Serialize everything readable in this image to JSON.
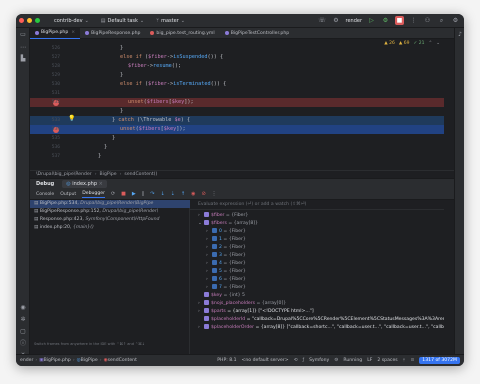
{
  "title_bar": {
    "project": "contrib-dev",
    "task": "Default task",
    "branch": "master",
    "run_config": "render"
  },
  "tabs": [
    {
      "label": "BigPipe.php",
      "color": "#8b7bd8",
      "active": true
    },
    {
      "label": "BigPipeResponse.php",
      "color": "#8b7bd8",
      "active": false
    },
    {
      "label": "big_pipe.test_routing.yml",
      "color": "#db5c5c",
      "active": false
    },
    {
      "label": "BigPipeTestController.php",
      "color": "#8b7bd8",
      "active": false
    }
  ],
  "editor": {
    "inspections": {
      "warnings": "26",
      "weak": "69",
      "typos": "21"
    },
    "lines": [
      {
        "num": "526",
        "code": "}"
      },
      {
        "num": "527",
        "code": "else if ($fiber->isSuspended()) {"
      },
      {
        "num": "528",
        "code": "$fiber->resume();"
      },
      {
        "num": "529",
        "code": "}"
      },
      {
        "num": "530",
        "code": "else if ($fiber->isTerminated()) {"
      },
      {
        "num": "531",
        "code": "unset($fibers[$key]);"
      },
      {
        "num": "532",
        "code": "}"
      },
      {
        "num": "533",
        "code": "} catch (\\Throwable $e) {"
      },
      {
        "num": "534",
        "code": "unset($fibers[$key]);"
      },
      {
        "num": "535",
        "code": "}"
      },
      {
        "num": "536",
        "code": "}"
      },
      {
        "num": "537",
        "code": "}"
      }
    ]
  },
  "breadcrumb": [
    "\\Drupal\\big_pipe\\Render",
    "BigPipe",
    "sendContent()"
  ],
  "debug": {
    "title": "Debug",
    "session": "index.php",
    "tabs": [
      "Console",
      "Output",
      "Debugger"
    ],
    "eval_placeholder": "Evaluate expression (⏎) or add a watch (⇧⌘⏎)",
    "frames": [
      {
        "text": "BigPipe.php:534, ",
        "ctx": "Drupal\\big_pipe\\Render\\BigPipe",
        "selected": true
      },
      {
        "text": "BigPipeResponse.php:152, ",
        "ctx": "Drupal\\big_pipe\\Render\\",
        "selected": false
      },
      {
        "text": "Response.php:423, ",
        "ctx": "Symfony\\Component\\HttpFound",
        "selected": false
      },
      {
        "text": "index.php:20, ",
        "ctx": "{main}()",
        "selected": false
      }
    ],
    "frames_hint": "Switch frames from anywhere in the IDE with ⌃⌘↑ and ⌃⌘↓",
    "vars": [
      {
        "indent": 0,
        "arrow": ">",
        "name": "$fiber",
        "value": "= {Fiber}"
      },
      {
        "indent": 0,
        "arrow": "v",
        "name": "$fibers",
        "value": "= {array[8]}"
      },
      {
        "indent": 1,
        "arrow": ">",
        "name": "0",
        "value": "= {Fiber}"
      },
      {
        "indent": 1,
        "arrow": ">",
        "name": "1",
        "value": "= {Fiber}"
      },
      {
        "indent": 1,
        "arrow": ">",
        "name": "2",
        "value": "= {Fiber}"
      },
      {
        "indent": 1,
        "arrow": ">",
        "name": "3",
        "value": "= {Fiber}"
      },
      {
        "indent": 1,
        "arrow": ">",
        "name": "4",
        "value": "= {Fiber}"
      },
      {
        "indent": 1,
        "arrow": ">",
        "name": "5",
        "value": "= {Fiber}"
      },
      {
        "indent": 1,
        "arrow": ">",
        "name": "6",
        "value": "= {Fiber}"
      },
      {
        "indent": 1,
        "arrow": ">",
        "name": "7",
        "value": "= {Fiber}"
      },
      {
        "indent": 0,
        "arrow": "",
        "name": "$key",
        "value": "= {int} 5"
      },
      {
        "indent": 0,
        "arrow": ">",
        "name": "$nojs_placeholders",
        "value": "= {array[0]}"
      },
      {
        "indent": 0,
        "arrow": ">",
        "name": "$parts",
        "value": "= {array[1]} [\"<!DOCTYPE html>...\"]"
      },
      {
        "indent": 0,
        "arrow": "",
        "name": "$placeholderId",
        "value": "= \"callback=Drupal%5CCore%5CRender%5CElement%5CStatusMessages%3A%3ArenderM"
      },
      {
        "indent": 0,
        "arrow": ">",
        "name": "$placeholderOrder",
        "value": "= {array[8]} [\"callback=shortc...\", \"callback=user.t...\", \"callback=user.t...\", \"callback=\""
      }
    ]
  },
  "status_bar": {
    "left": [
      "ender",
      "BigPipe.php",
      "BigPipe",
      "sendContent"
    ],
    "php": "PHP: 8.1",
    "server": "<no default server>",
    "framework": "Symfony",
    "running": "Running",
    "line_sep": "LF",
    "indent": "2 spaces",
    "memory": "1317 of 3072M"
  }
}
